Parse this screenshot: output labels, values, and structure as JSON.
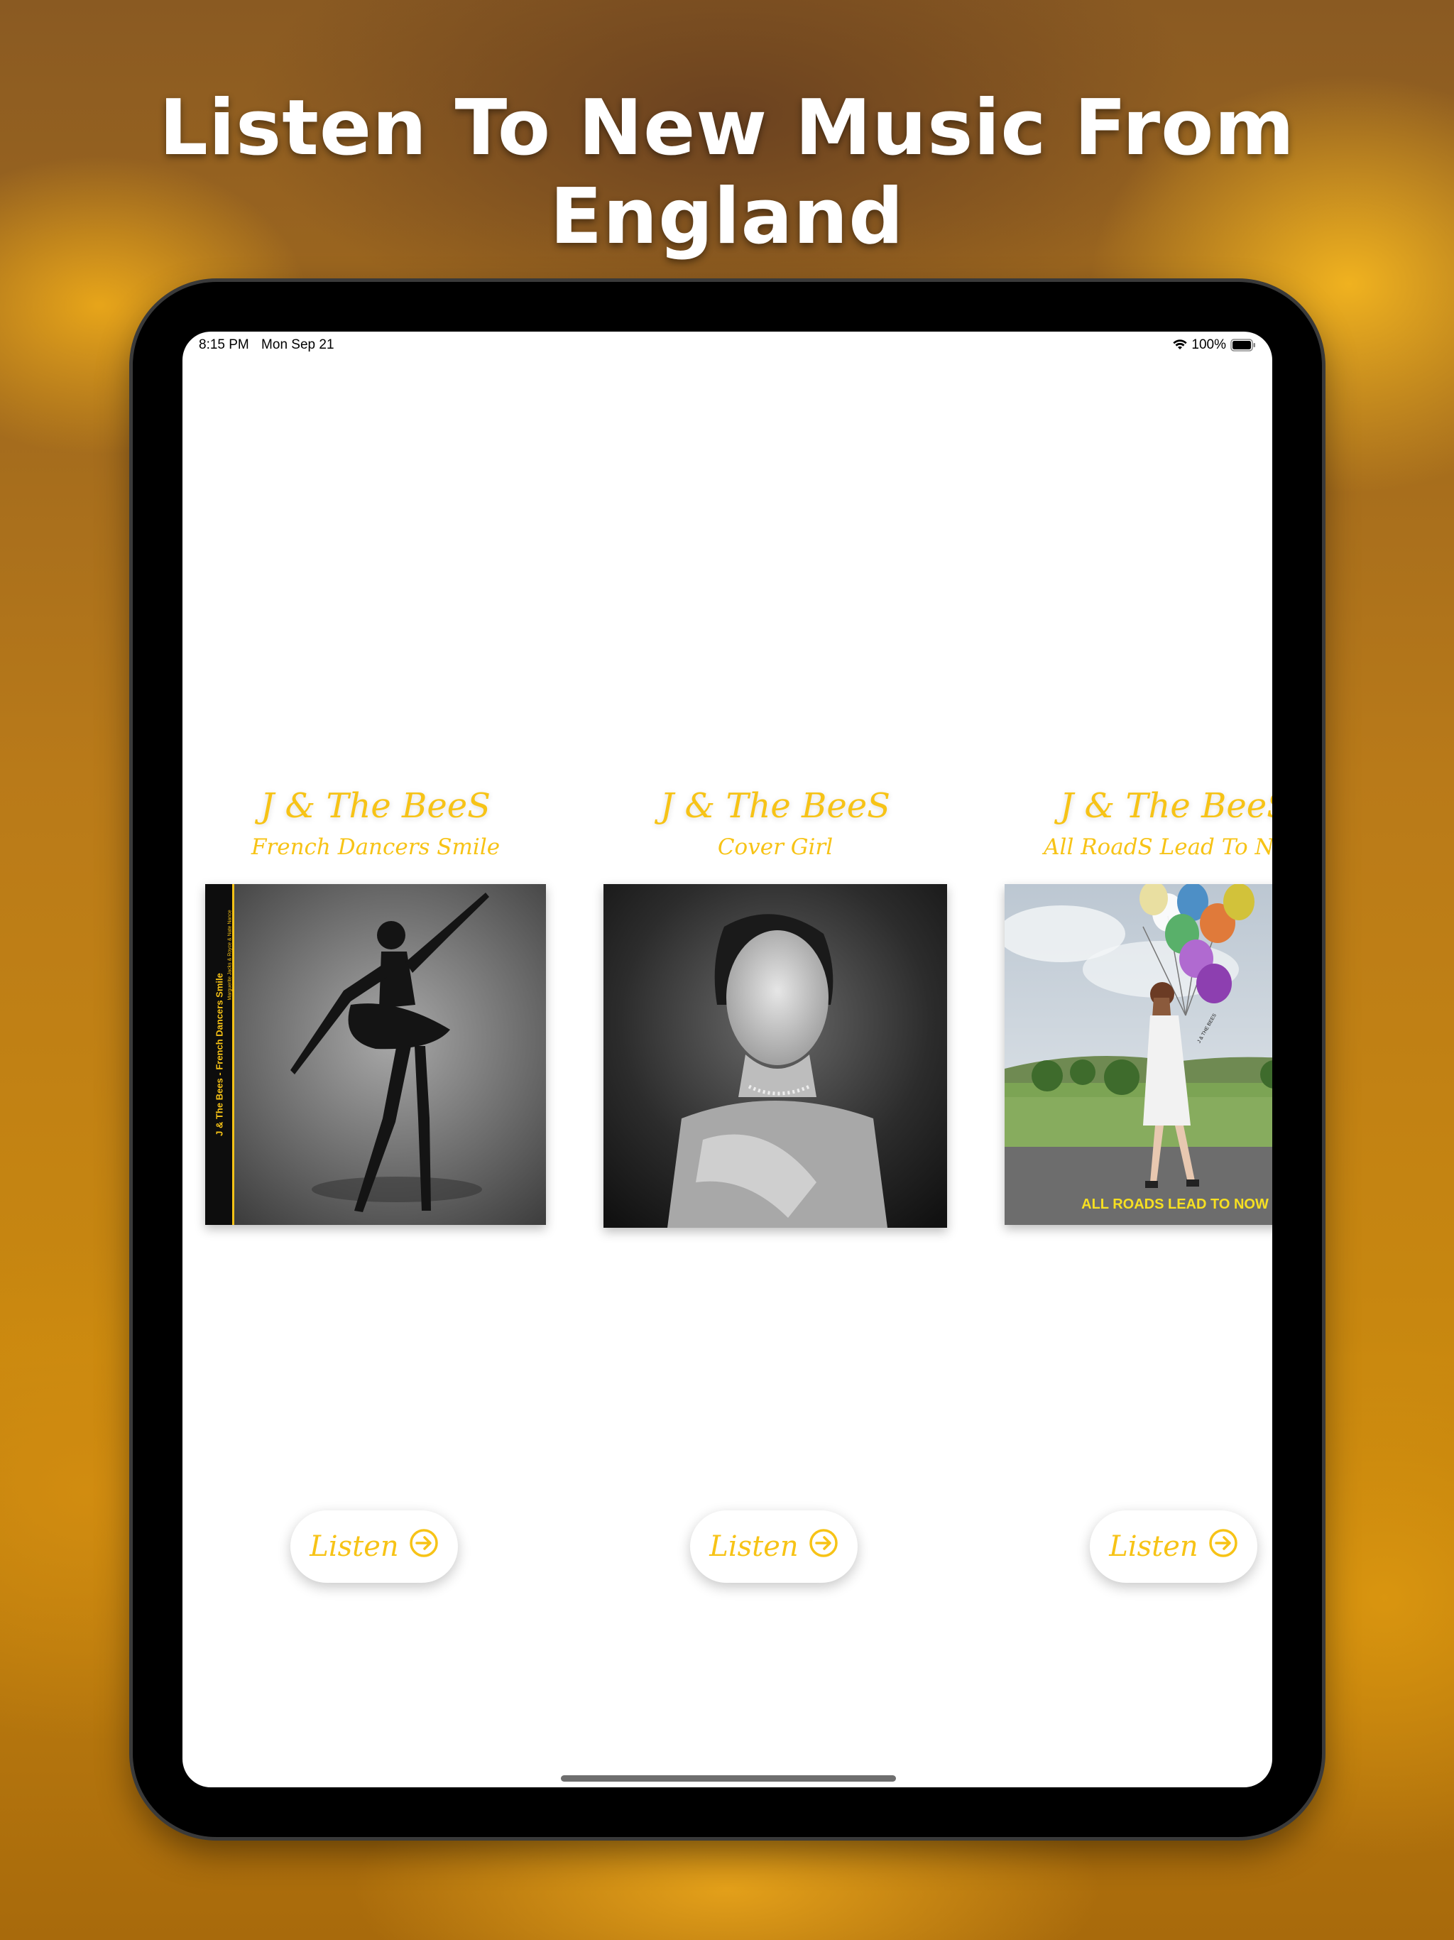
{
  "headline": "Listen To New Music From England",
  "status_bar": {
    "time": "8:15 PM",
    "date": "Mon Sep 21",
    "battery": "100%"
  },
  "albums": [
    {
      "artist": "J & The BeeS",
      "title": "French Dancers Smile",
      "button": "Listen",
      "cover_text": "J & The Bees - French Dancers Smile",
      "cover_subtext": "Marguerite Jacks & Royce & Nate Nance"
    },
    {
      "artist": "J & The BeeS",
      "title": "Cover Girl",
      "button": "Listen"
    },
    {
      "artist": "J & The BeeS",
      "title": "All RoadS Lead To Now",
      "button": "Listen",
      "cover_text": "ALL ROADS LEAD TO NOW",
      "balloon_text": "J & THE BEES"
    }
  ],
  "colors": {
    "accent": "#f7c316",
    "device": "#000000",
    "screen": "#ffffff"
  }
}
